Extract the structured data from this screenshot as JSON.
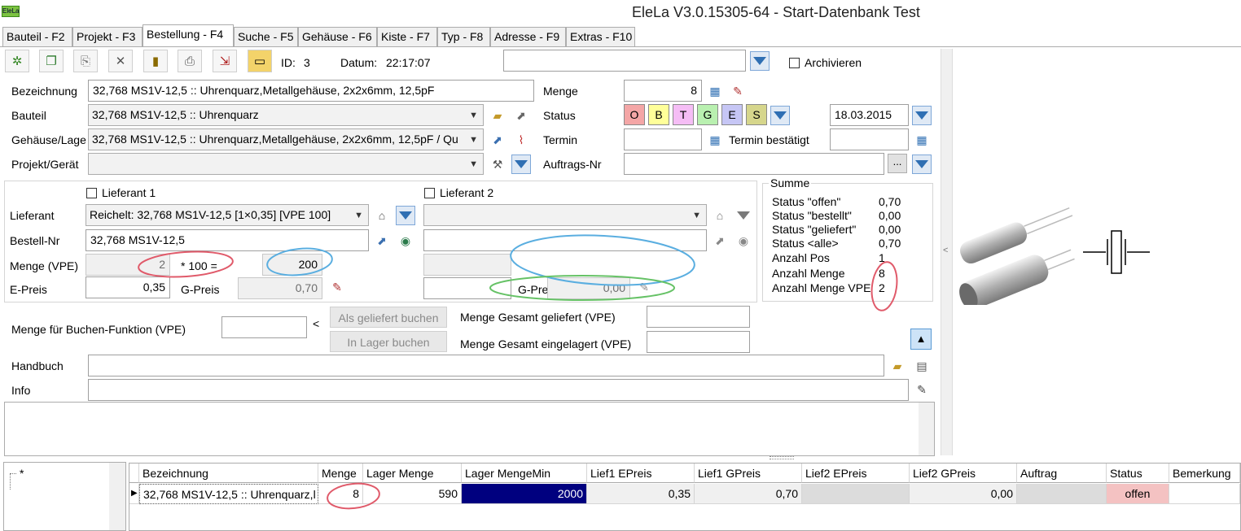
{
  "window": {
    "app_icon": "EleLa",
    "title": "EleLa V3.0.15305-64  - Start-Datenbank Test"
  },
  "tabs": [
    "Bauteil - F2",
    "Projekt - F3",
    "Bestellung - F4",
    "Suche - F5",
    "Gehäuse - F6",
    "Kiste - F7",
    "Typ - F8",
    "Adresse - F9",
    "Extras - F10"
  ],
  "toolbar": {
    "id_label": "ID:",
    "id_value": "3",
    "datum_label": "Datum:",
    "datum_value": "22:17:07",
    "search_value": "",
    "archive_label": "Archivieren"
  },
  "form": {
    "bezeichnung_label": "Bezeichnung",
    "bezeichnung_value": "32,768 MS1V-12,5 :: Uhrenquarz,Metallgehäuse, 2x2x6mm, 12,5pF",
    "bauteil_label": "Bauteil",
    "bauteil_value": "32,768 MS1V-12,5 :: Uhrenquarz",
    "gehaeuse_label": "Gehäuse/Lage",
    "gehaeuse_value": "32,768 MS1V-12,5 :: Uhrenquarz,Metallgehäuse, 2x2x6mm, 12,5pF / Qu",
    "projekt_label": "Projekt/Gerät",
    "projekt_value": "",
    "menge_label": "Menge",
    "menge_value": "8",
    "status_label": "Status",
    "status_letters": [
      "O",
      "B",
      "T",
      "G",
      "E",
      "S"
    ],
    "status_colors": [
      "#f4a6a6",
      "#ffff99",
      "#f5bdf5",
      "#b9f0b0",
      "#c6c6f5",
      "#d6d68c"
    ],
    "status_date": "18.03.2015",
    "termin_label": "Termin",
    "termin_value": "",
    "termin_bestaetigt_label": "Termin bestätigt",
    "termin_bestaetigt_value": "",
    "auftrags_label": "Auftrags-Nr",
    "auftrags_value": "",
    "auftrags_btn": "..."
  },
  "lieferanten": {
    "l1_check_label": "Lieferant 1",
    "l2_check_label": "Lieferant 2",
    "lieferant_label": "Lieferant",
    "l1_lieferant_value": "Reichelt: 32,768 MS1V-12,5 [1×0,35] [VPE 100]",
    "l2_lieferant_value": "",
    "bestellnr_label": "Bestell-Nr",
    "l1_bestellnr_value": "32,768 MS1V-12,5",
    "l2_bestellnr_value": "",
    "menge_vpe_label": "Menge (VPE)",
    "l1_menge_vpe": "2",
    "multiplier_text": "* 100 =",
    "l1_total": "200",
    "epreis_label": "E-Preis",
    "l1_epreis": "0,35",
    "gpreis_label": "G-Preis",
    "l1_gpreis": "0,70",
    "l2_gpreis_label": "G-Prei",
    "l2_gpreis": "0,00"
  },
  "summe": {
    "title": "Summe",
    "rows": [
      {
        "label": "Status \"offen\"",
        "value": "0,70"
      },
      {
        "label": "Status \"bestellt\"",
        "value": "0,00"
      },
      {
        "label": "Status \"geliefert\"",
        "value": "0,00"
      },
      {
        "label": "Status <alle>",
        "value": "0,70"
      },
      {
        "label": "Anzahl Pos",
        "value": "1"
      },
      {
        "label": "Anzahl Menge",
        "value": "8"
      },
      {
        "label": "Anzahl Menge VPE",
        "value": "2"
      }
    ]
  },
  "buchen": {
    "label": "Menge für Buchen-Funktion (VPE)",
    "value": "",
    "lt": "<",
    "als_geliefert_btn": "Als geliefert buchen",
    "in_lager_btn": "In Lager buchen",
    "gesamt_geliefert_label": "Menge Gesamt geliefert (VPE)",
    "gesamt_geliefert_value": "",
    "gesamt_eingelagert_label": "Menge Gesamt eingelagert (VPE)",
    "gesamt_eingelagert_value": ""
  },
  "handbuch": {
    "label": "Handbuch",
    "value": ""
  },
  "info": {
    "label": "Info",
    "value": ""
  },
  "tree": {
    "root": "*"
  },
  "grid": {
    "columns": [
      "Bezeichnung",
      "Menge",
      "Lager Menge",
      "Lager MengeMin",
      "Lief1 EPreis",
      "Lief1 GPreis",
      "Lief2 EPreis",
      "Lief2 GPreis",
      "Auftrag",
      "Status",
      "Bemerkung"
    ],
    "rows": [
      [
        "32,768 MS1V-12,5 :: Uhrenquarz,l",
        "8",
        "590",
        "2000",
        "0,35",
        "0,70",
        "",
        "0,00",
        "",
        "offen",
        ""
      ]
    ]
  },
  "colors": {
    "selected_cell": "#00007f",
    "status_offen": "#f4c2c2",
    "annotation_red": "#e05a6a",
    "annotation_blue": "#5aaee0",
    "annotation_green": "#66c266"
  }
}
